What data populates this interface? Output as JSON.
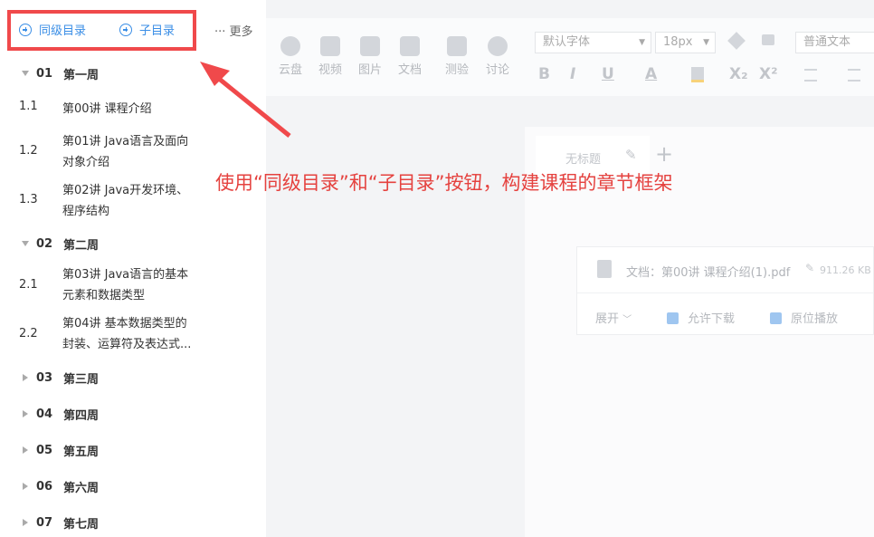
{
  "sidebar": {
    "sibling_btn": "同级目录",
    "child_btn": "子目录",
    "more": "··· 更多",
    "weeks": [
      {
        "num": "01",
        "name": "第一周",
        "expanded": true
      },
      {
        "num": "02",
        "name": "第二周",
        "expanded": true
      },
      {
        "num": "03",
        "name": "第三周",
        "expanded": false
      },
      {
        "num": "04",
        "name": "第四周",
        "expanded": false
      },
      {
        "num": "05",
        "name": "第五周",
        "expanded": false
      },
      {
        "num": "06",
        "name": "第六周",
        "expanded": false
      },
      {
        "num": "07",
        "name": "第七周",
        "expanded": false
      }
    ],
    "lessons": [
      {
        "num": "1.1",
        "l1": "第00讲 课程介绍",
        "l2": ""
      },
      {
        "num": "1.2",
        "l1": "第01讲 Java语言及面向",
        "l2": "对象介绍"
      },
      {
        "num": "1.3",
        "l1": "第02讲 Java开发环境、",
        "l2": "程序结构"
      },
      {
        "num": "2.1",
        "l1": "第03讲 Java语言的基本",
        "l2": "元素和数据类型"
      },
      {
        "num": "2.2",
        "l1": "第04讲 基本数据类型的",
        "l2": "封装、运算符及表达式..."
      }
    ]
  },
  "toolbar": {
    "items": [
      "云盘",
      "视频",
      "图片",
      "文档",
      "测验",
      "讨论"
    ],
    "font": "默认字体",
    "size": "18px",
    "style": "普通文本",
    "format": [
      "B",
      "I",
      "U",
      "A",
      "X₂",
      "X²"
    ]
  },
  "editor": {
    "tab_title": "无标题",
    "file_label": "文档：第00讲 课程介绍(1).pdf",
    "file_size": "911.26 KB",
    "expand": "展开",
    "allow_download": "允许下载",
    "original_play": "原位播放"
  },
  "annotation": "使用“同级目录”和“子目录”按钮，构建课程的章节框架",
  "colors": {
    "accent": "#3a8ee6",
    "annotation": "#f0494b"
  }
}
